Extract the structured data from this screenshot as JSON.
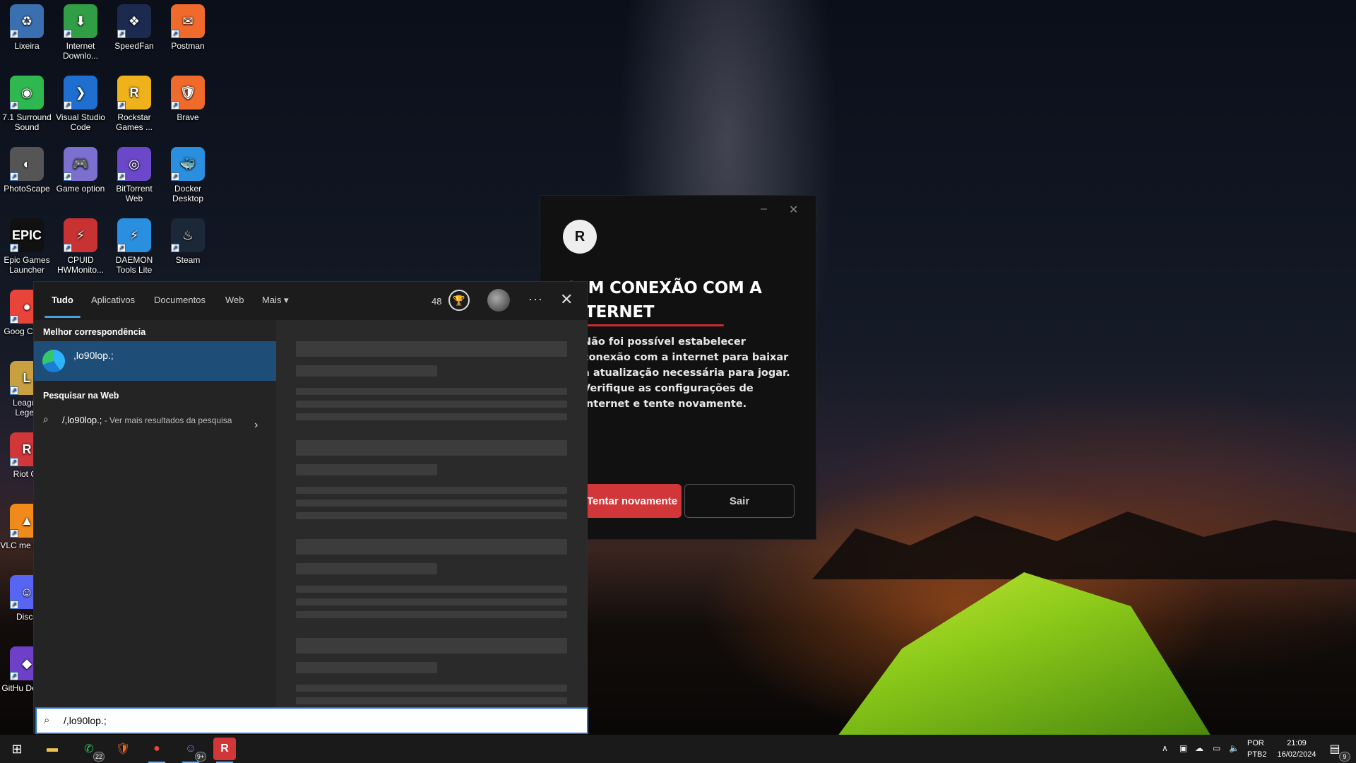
{
  "desktop": {
    "icons": [
      {
        "label": "Lixeira",
        "glyph": "♻"
      },
      {
        "label": "Internet Downlo...",
        "glyph": "⬇"
      },
      {
        "label": "SpeedFan",
        "glyph": "❖"
      },
      {
        "label": "Postman",
        "glyph": "✉"
      },
      {
        "label": "7.1 Surround Sound",
        "glyph": "◉"
      },
      {
        "label": "Visual Studio Code",
        "glyph": "❯"
      },
      {
        "label": "Rockstar Games ...",
        "glyph": "R"
      },
      {
        "label": "Brave",
        "glyph": "🛡"
      },
      {
        "label": "PhotoScape",
        "glyph": "◐"
      },
      {
        "label": "Game option",
        "glyph": "🎮"
      },
      {
        "label": "BitTorrent Web",
        "glyph": "◎"
      },
      {
        "label": "Docker Desktop",
        "glyph": "🐳"
      },
      {
        "label": "Epic Games Launcher",
        "glyph": "EPIC"
      },
      {
        "label": "CPUID HWMonito...",
        "glyph": "⚡"
      },
      {
        "label": "DAEMON Tools Lite",
        "glyph": "⚡"
      },
      {
        "label": "Steam",
        "glyph": "♨"
      },
      {
        "label": "Goog Chron",
        "glyph": "●"
      },
      {
        "label": "League Legen",
        "glyph": "L"
      },
      {
        "label": "Riot Cli",
        "glyph": "R"
      },
      {
        "label": "VLC me playe",
        "glyph": "▲"
      },
      {
        "label": "Disco",
        "glyph": "☺"
      },
      {
        "label": "GitHu Deskto",
        "glyph": "◆"
      }
    ]
  },
  "riot_dialog": {
    "minimize": "–",
    "close": "✕",
    "logo": "R",
    "title": "SEM CONEXÃO COM A INTERNET",
    "message": "Não foi possível estabelecer conexão com a internet para baixar a atualização necessária para jogar. Verifique as configurações de internet e tente novamente.",
    "retry_label": "Tentar novamente",
    "exit_label": "Sair"
  },
  "search": {
    "tabs": [
      "Tudo",
      "Aplicativos",
      "Documentos",
      "Web",
      "Mais ▾"
    ],
    "points": "48",
    "more": "···",
    "close": "✕",
    "best_match_header": "Melhor correspondência",
    "best_match_name": ",lo90lop.;",
    "web_header": "Pesquisar na Web",
    "web_query": "/,lo90lop.;",
    "web_hint": " - Ver mais resultados da pesquisa",
    "input_value": "/,lo90lop.;"
  },
  "taskbar": {
    "whatsapp_badge": "22",
    "discord_badge": "9+",
    "lang_line1": "POR",
    "lang_line2": "PTB2",
    "time": "21:09",
    "date": "16/02/2024",
    "notif_badge": "9"
  }
}
